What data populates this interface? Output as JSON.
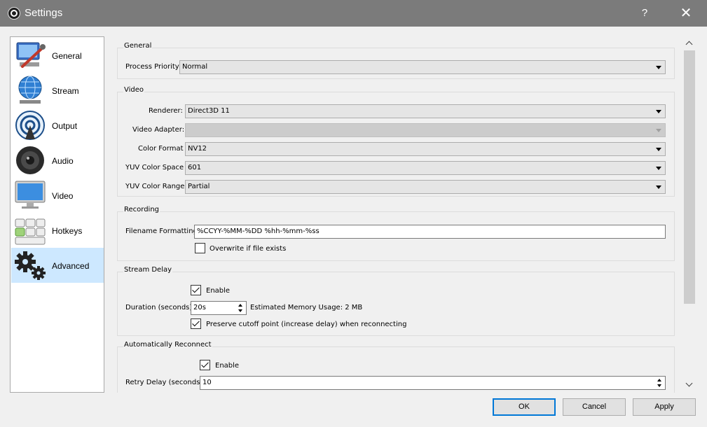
{
  "window": {
    "title": "Settings",
    "help_label": "?",
    "close_label": "✕"
  },
  "sidebar": {
    "items": [
      {
        "label": "General",
        "icon": "general-icon",
        "active": false
      },
      {
        "label": "Stream",
        "icon": "stream-icon",
        "active": false
      },
      {
        "label": "Output",
        "icon": "output-icon",
        "active": false
      },
      {
        "label": "Audio",
        "icon": "audio-icon",
        "active": false
      },
      {
        "label": "Video",
        "icon": "video-icon",
        "active": false
      },
      {
        "label": "Hotkeys",
        "icon": "hotkeys-icon",
        "active": false
      },
      {
        "label": "Advanced",
        "icon": "advanced-icon",
        "active": true
      }
    ]
  },
  "general": {
    "title": "General",
    "process_priority_label": "Process Priority",
    "process_priority_value": "Normal"
  },
  "video": {
    "title": "Video",
    "renderer_label": "Renderer:",
    "renderer_value": "Direct3D 11",
    "adapter_label": "Video Adapter:",
    "adapter_value": "",
    "color_format_label": "Color Format",
    "color_format_value": "NV12",
    "color_space_label": "YUV Color Space",
    "color_space_value": "601",
    "color_range_label": "YUV Color Range",
    "color_range_value": "Partial"
  },
  "recording": {
    "title": "Recording",
    "filename_label": "Filename Formatting",
    "filename_value": "%CCYY-%MM-%DD %hh-%mm-%ss",
    "overwrite_label": "Overwrite if file exists",
    "overwrite_checked": false
  },
  "stream_delay": {
    "title": "Stream Delay",
    "enable_label": "Enable",
    "enable_checked": true,
    "duration_label": "Duration (seconds)",
    "duration_value": "20s",
    "memory_label": "Estimated Memory Usage: 2 MB",
    "preserve_label": "Preserve cutoff point (increase delay) when reconnecting",
    "preserve_checked": true
  },
  "reconnect": {
    "title": "Automatically Reconnect",
    "enable_label": "Enable",
    "enable_checked": true,
    "retry_label": "Retry Delay (seconds)",
    "retry_value": "10"
  },
  "buttons": {
    "ok": "OK",
    "cancel": "Cancel",
    "apply": "Apply"
  },
  "colors": {
    "titlebar": "#7b7b7b",
    "selection": "#cde8ff",
    "focus_border": "#0078d7"
  }
}
